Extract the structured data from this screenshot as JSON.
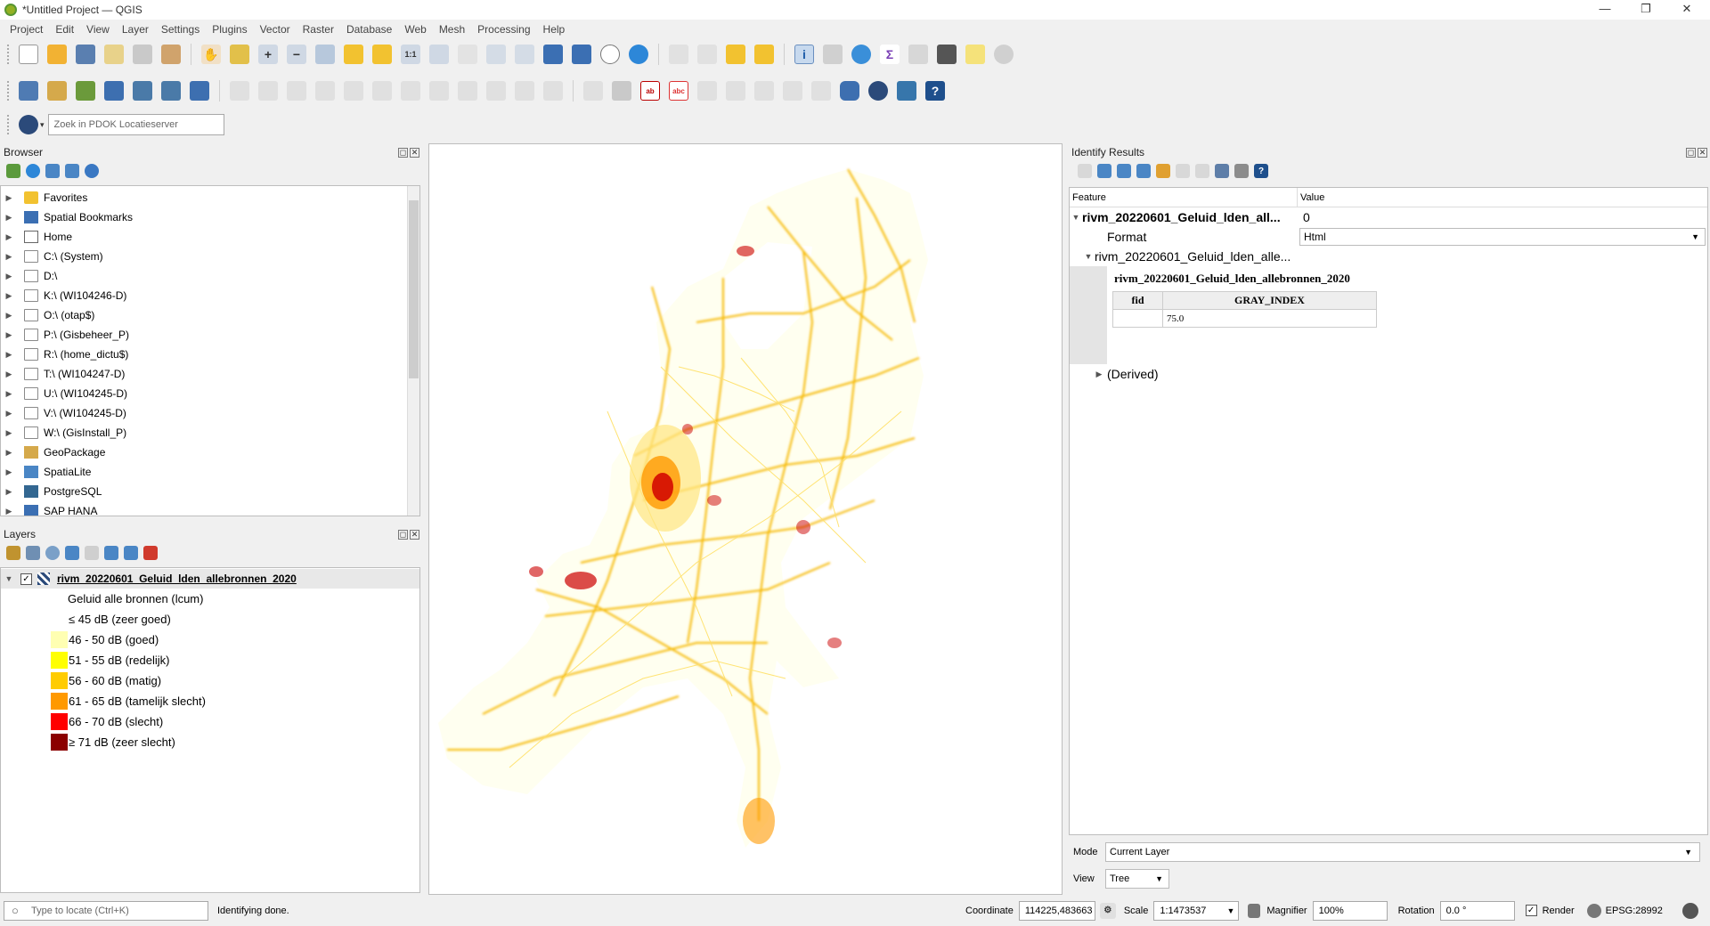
{
  "window": {
    "title": "*Untitled Project — QGIS",
    "minimize": "—",
    "maximize": "❐",
    "close": "✕"
  },
  "menu": [
    "Project",
    "Edit",
    "View",
    "Layer",
    "Settings",
    "Plugins",
    "Vector",
    "Raster",
    "Database",
    "Web",
    "Mesh",
    "Processing",
    "Help"
  ],
  "locator_search": {
    "placeholder": "Zoek in PDOK Locatieserver"
  },
  "browser": {
    "title": "Browser",
    "items": [
      {
        "label": "Favorites",
        "icon": "star-icon"
      },
      {
        "label": "Spatial Bookmarks",
        "icon": "bookmark-icon"
      },
      {
        "label": "Home",
        "icon": "home-icon"
      },
      {
        "label": "C:\\ (System)",
        "icon": "folder-icon"
      },
      {
        "label": "D:\\",
        "icon": "folder-icon"
      },
      {
        "label": "K:\\ (WI104246-D)",
        "icon": "folder-icon"
      },
      {
        "label": "O:\\ (otap$)",
        "icon": "folder-icon"
      },
      {
        "label": "P:\\ (Gisbeheer_P)",
        "icon": "folder-icon"
      },
      {
        "label": "R:\\ (home_dictu$)",
        "icon": "folder-icon"
      },
      {
        "label": "T:\\ (WI104247-D)",
        "icon": "folder-icon"
      },
      {
        "label": "U:\\ (WI104245-D)",
        "icon": "folder-icon"
      },
      {
        "label": "V:\\ (WI104245-D)",
        "icon": "folder-icon"
      },
      {
        "label": "W:\\ (GisInstall_P)",
        "icon": "folder-icon"
      },
      {
        "label": "GeoPackage",
        "icon": "geopackage-icon"
      },
      {
        "label": "SpatiaLite",
        "icon": "spatialite-icon"
      },
      {
        "label": "PostgreSQL",
        "icon": "postgresql-icon"
      },
      {
        "label": "SAP HANA",
        "icon": "sap-hana-icon"
      }
    ]
  },
  "layers": {
    "title": "Layers",
    "layer_name": "rivm_20220601_Geluid_lden_allebronnen_2020",
    "legend_title": "Geluid alle bronnen (lcum)",
    "legend": [
      {
        "label": "≤ 45 dB (zeer goed)",
        "color": "#ffffff"
      },
      {
        "label": "46 - 50 dB (goed)",
        "color": "#ffffb2"
      },
      {
        "label": "51 - 55 dB (redelijk)",
        "color": "#ffff00"
      },
      {
        "label": "56 - 60 dB (matig)",
        "color": "#ffcc00"
      },
      {
        "label": "61 - 65 dB (tamelijk slecht)",
        "color": "#ff9900"
      },
      {
        "label": "66 - 70 dB (slecht)",
        "color": "#ff0000"
      },
      {
        "label": "≥ 71 dB (zeer slecht)",
        "color": "#8b0000"
      }
    ]
  },
  "identify": {
    "title": "Identify Results",
    "col_feature": "Feature",
    "col_value": "Value",
    "feature_name": "rivm_20220601_Geluid_lden_all...",
    "feature_value": "0",
    "format_label": "Format",
    "format_value": "Html",
    "sub_feature": "rivm_20220601_Geluid_lden_alle...",
    "html_title": "rivm_20220601_Geluid_lden_allebronnen_2020",
    "html_col1": "fid",
    "html_col2": "GRAY_INDEX",
    "html_val": "75.0",
    "derived": "(Derived)",
    "mode_label": "Mode",
    "mode_value": "Current Layer",
    "view_label": "View",
    "view_value": "Tree"
  },
  "status": {
    "locate_placeholder": "Type to locate (Ctrl+K)",
    "message": "Identifying done.",
    "coordinate_label": "Coordinate",
    "coordinate_value": "114225,483663",
    "scale_label": "Scale",
    "scale_value": "1:1473537",
    "magnifier_label": "Magnifier",
    "magnifier_value": "100%",
    "rotation_label": "Rotation",
    "rotation_value": "0.0 °",
    "render_label": "Render",
    "crs": "EPSG:28992"
  }
}
